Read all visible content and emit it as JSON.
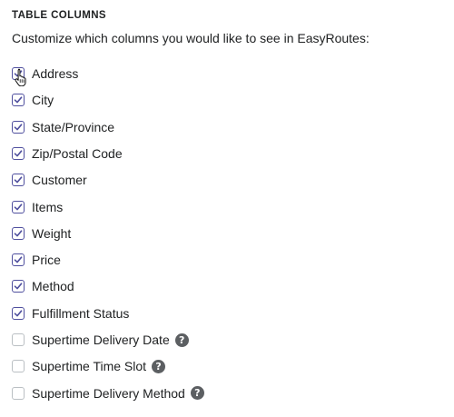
{
  "section": {
    "title": "TABLE COLUMNS",
    "description": "Customize which columns you would like to see in EasyRoutes:"
  },
  "colors": {
    "checked_border": "#4f4f9e",
    "check_mark": "#4f4f9e",
    "unchecked_border": "#babfc3",
    "help_icon_bg": "#5c5f62"
  },
  "columns": [
    {
      "label": "Address",
      "checked": true,
      "help": false
    },
    {
      "label": "City",
      "checked": true,
      "help": false
    },
    {
      "label": "State/Province",
      "checked": true,
      "help": false
    },
    {
      "label": "Zip/Postal Code",
      "checked": true,
      "help": false
    },
    {
      "label": "Customer",
      "checked": true,
      "help": false
    },
    {
      "label": "Items",
      "checked": true,
      "help": false
    },
    {
      "label": "Weight",
      "checked": true,
      "help": false
    },
    {
      "label": "Price",
      "checked": true,
      "help": false
    },
    {
      "label": "Method",
      "checked": true,
      "help": false
    },
    {
      "label": "Fulfillment Status",
      "checked": true,
      "help": false
    },
    {
      "label": "Supertime Delivery Date",
      "checked": false,
      "help": true
    },
    {
      "label": "Supertime Time Slot",
      "checked": false,
      "help": true
    },
    {
      "label": "Supertime Delivery Method",
      "checked": false,
      "help": true
    }
  ],
  "help_icon_glyph": "?",
  "cursor": {
    "icon": "hand-pointer-icon"
  }
}
